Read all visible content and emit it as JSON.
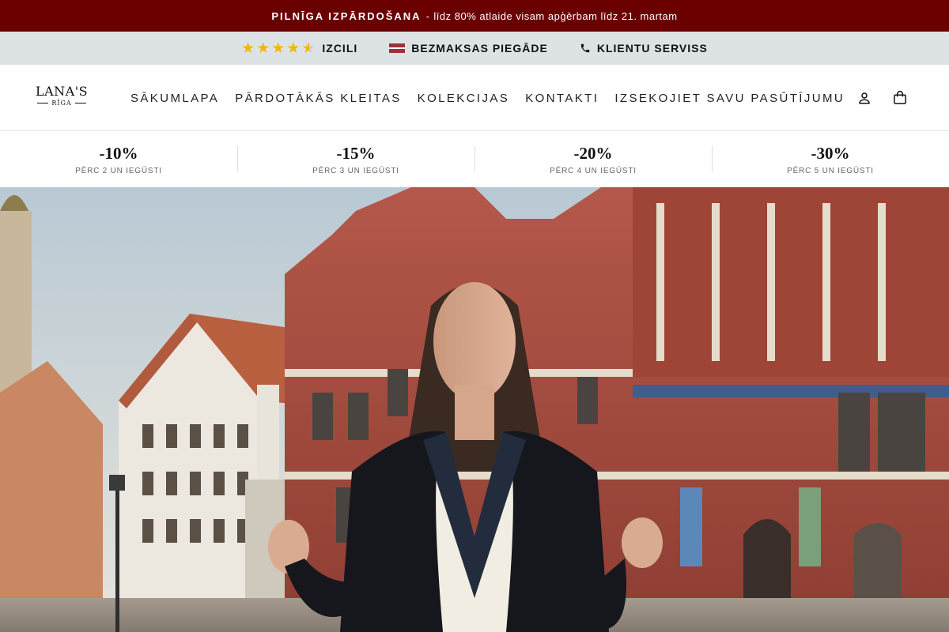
{
  "announcement": {
    "strong": "PILNĪGA IZPĀRDOŠANA",
    "separator": "-",
    "text": "līdz 80% atlaide visam apģērbam līdz 21. martam"
  },
  "trust_bar": {
    "rating_label": "IZCILI",
    "rating_stars": 4.5,
    "shipping_label": "BEZMAKSAS PIEGĀDE",
    "service_label": "KLIENTU SERVISS"
  },
  "brand": {
    "name": "LANA'S",
    "city": "RĪGA"
  },
  "nav": {
    "items": [
      {
        "label": "SĀKUMLAPA"
      },
      {
        "label": "PĀRDOTĀKĀS KLEITAS"
      },
      {
        "label": "KOLEKCIJAS"
      },
      {
        "label": "KONTAKTI"
      },
      {
        "label": "IZSEKOJIET SAVU PASŪTĪJUMU"
      }
    ]
  },
  "header_icons": [
    "account-icon",
    "cart-icon"
  ],
  "discounts": [
    {
      "pct": "-10%",
      "sub": "PĒRC 2 UN IEGŪSTI"
    },
    {
      "pct": "-15%",
      "sub": "PĒRC 3 UN IEGŪSTI"
    },
    {
      "pct": "-20%",
      "sub": "PĒRC 4 UN IEGŪSTI"
    },
    {
      "pct": "-30%",
      "sub": "PĒRC 5 UN IEGŪSTI"
    }
  ],
  "colors": {
    "announcement_bg": "#6a0000",
    "trust_bg": "#dde3e5",
    "star": "#f2b705"
  }
}
